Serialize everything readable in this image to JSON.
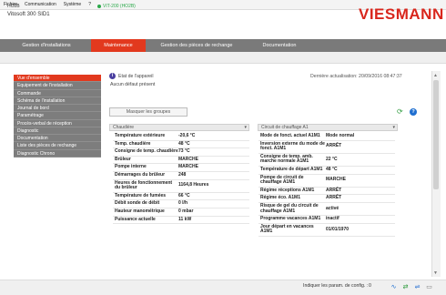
{
  "menubar": {
    "items": [
      "Fichier",
      "Communication",
      "Système",
      "?"
    ]
  },
  "header": {
    "device_title": "Vitosoft 300 SID1",
    "logo_text": "VIESMANN"
  },
  "nav": {
    "tabs": [
      {
        "label": "Gestion d'installations",
        "active": false
      },
      {
        "label": "Maintenance",
        "active": true
      },
      {
        "label": "Gestion des pièces de rechange",
        "active": false
      },
      {
        "label": "Documentation",
        "active": false
      }
    ]
  },
  "status_strip": {
    "left_text": "HO2B",
    "device_text": "VIT-200 (HO2B)"
  },
  "sidebar": {
    "items": [
      {
        "label": "Vue d'ensemble",
        "active": true
      },
      {
        "label": "Equipement de l'installation",
        "active": false
      },
      {
        "label": "Commande",
        "active": false
      },
      {
        "label": "Schéma de l'installation",
        "active": false
      },
      {
        "label": "Journal de bord",
        "active": false
      },
      {
        "label": "Paramétrage",
        "active": false
      },
      {
        "label": "Procès-verbal de réception",
        "active": false
      },
      {
        "label": "Diagnostic",
        "active": false
      },
      {
        "label": "Documentation",
        "active": false
      },
      {
        "label": "Liste des pièces de rechange",
        "active": false
      },
      {
        "label": "Diagnostic Chrono",
        "active": false
      }
    ]
  },
  "content": {
    "etat_label": "Etat de l'appareil",
    "etat_default": "Aucun défaut présent",
    "last_update": "Dernière actualisation: 20/09/2016 08:47:37",
    "masquer_button": "Masquer les groupes",
    "left_select": "Chaudière",
    "right_select": "Circuit de chauffage A1"
  },
  "left_table": [
    {
      "label": "Température extérieure",
      "value": "-20,6 °C"
    },
    {
      "label": "Temp. chaudière",
      "value": "48 °C"
    },
    {
      "label": "Consigne de temp. chaudière",
      "value": "73 °C"
    },
    {
      "label": "Brûleur",
      "value": "MARCHE"
    },
    {
      "label": "Pompe interne",
      "value": "MARCHE"
    },
    {
      "label": "Démarrages du brûleur",
      "value": "248"
    },
    {
      "label": "Heures de fonctionnement du brûleur",
      "value": "1164,8 Heures"
    },
    {
      "label": "Température de fumées",
      "value": "66 °C"
    },
    {
      "label": "Débit sonde de débit",
      "value": "0 l/h"
    },
    {
      "label": "Hauteur manométrique",
      "value": "0 mbar"
    },
    {
      "label": "Puissance actuelle",
      "value": "11 kW"
    }
  ],
  "right_table": [
    {
      "label": "Mode de fonct. actuel A1M1",
      "value": "Mode normal"
    },
    {
      "label": "Inversion externe du mode de fonct. A1M1",
      "value": "ARRÊT"
    },
    {
      "label": "Consigne de temp. amb. marche normale A1M1",
      "value": "22 °C"
    },
    {
      "label": "Température de départ A1M1",
      "value": "48 °C"
    },
    {
      "label": "Pompe de circuit de chauffage A1M1",
      "value": "MARCHE"
    },
    {
      "label": "Régime réceptions A1M1",
      "value": "ARRÊT"
    },
    {
      "label": "Régime éco. A1M1",
      "value": "ARRÊT"
    },
    {
      "label": "Risque de gel du circuit de chauffage A1M1",
      "value": "activé"
    },
    {
      "label": "Programme vacances A1M1",
      "value": "inactif"
    },
    {
      "label": "Jour départ en vacances A1M1",
      "value": "01/01/1970"
    }
  ],
  "bottom": {
    "config_label": "Indiquer les param. de config. :",
    "config_value": "0"
  },
  "colors": {
    "accent": "#e2391e",
    "nav_gray": "#7a7a7a",
    "sidebar_gray": "#7d7d7d",
    "online_green": "#2ba84a",
    "logo_red": "#d9261c"
  },
  "icons": [
    "info-icon",
    "refresh-icon",
    "help-icon",
    "status-online-icon",
    "chevron-down-icon"
  ]
}
